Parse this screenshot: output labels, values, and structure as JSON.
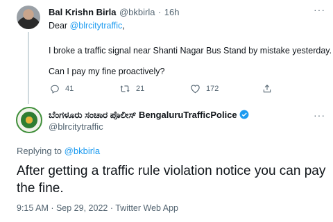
{
  "reply_tweet": {
    "author_name": "Bal Krishn Birla",
    "author_handle": "@bkbirla",
    "separator": "·",
    "time": "16h",
    "greeting_prefix": "Dear ",
    "greeting_mention": "@blrcitytraffic",
    "greeting_suffix": ",",
    "line1": "I broke a traffic signal near Shanti Nagar Bus Stand by mistake yesterday.",
    "line2": "Can I pay my fine proactively?",
    "replies": "41",
    "retweets": "21",
    "likes": "172",
    "more_label": "···"
  },
  "main_tweet": {
    "author_name": "ಬೆಂಗಳೂರು ಸಂಚಾರ ಪೊಲೀಸ್ BengaluruTrafficPolice",
    "author_handle": "@blrcitytraffic",
    "more_label": "···",
    "replying_prefix": "Replying to ",
    "replying_handle": "@bkbirla",
    "text": "After getting a traffic rule violation notice you can pay the fine.",
    "meta": "9:15 AM · Sep 29, 2022 · Twitter Web App"
  },
  "colors": {
    "link": "#1d9bf0",
    "secondary": "#536471",
    "verified": "#1d9bf0"
  },
  "icons": [
    "reply-icon",
    "retweet-icon",
    "like-icon",
    "share-icon",
    "verified-badge-icon",
    "more-icon"
  ]
}
